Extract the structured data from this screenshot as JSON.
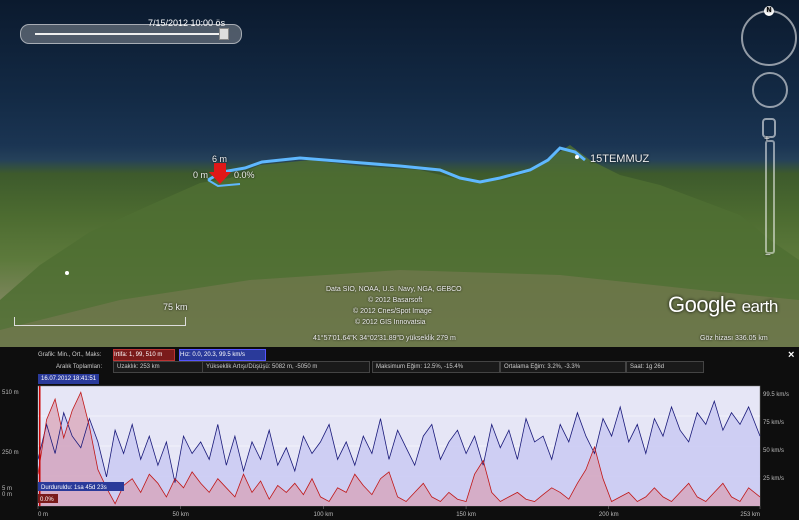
{
  "map": {
    "time_label": "7/15/2012  10:00 ös",
    "place_label": "15TEMMUZ",
    "marker_elev": "6 m",
    "marker_zero": "0 m",
    "marker_pct": "0.0%",
    "scale_label": "75 km",
    "attribution": [
      "Data SIO, NOAA, U.S. Navy, NGA, GEBCO",
      "© 2012 Basarsoft",
      "© 2012 Cnes/Spot Image",
      "© 2012 GIS Innovatsia"
    ],
    "coords": "41°57'01.64\"K  34°02'31.89\"D  yükseklik  279 m",
    "eye_alt": "Göz hizası  336.05 km",
    "logo_google": "Google",
    "logo_earth": "earth",
    "compass_n": "N"
  },
  "panel": {
    "graph_label": "Grafik: Min., Ort., Maks:",
    "elev_stats": "Irtifa: 1, 99, 510 m",
    "speed_stats": "Hız: 0.0, 20.3, 99.5 km/s",
    "range_label": "Aralık Toplamları:",
    "distance": "Uzaklık: 253 km",
    "elev_gain": "Yükseklik Artışı/Düşüşü: 5082 m, -5050 m",
    "max_slope": "Maksimum Eğim: 12.5%, -15.4%",
    "avg_slope": "Ortalama Eğim: 3.2%, -3.3%",
    "time": "Saat: 1g 26d",
    "timestamp": "16.07.2012 18:41:51",
    "stop_label": "Durduruldu: 1sa 45d 23s",
    "close": "×"
  },
  "chart_data": {
    "type": "area",
    "y_left_ticks": [
      "510 m",
      "250 m",
      "5 m"
    ],
    "y_left_minor": "0 m",
    "y_right_ticks": [
      "99.5 km/s",
      "75 km/s",
      "50 km/s",
      "25 km/s"
    ],
    "x_ticks": [
      "0 m",
      "50 km",
      "100 km",
      "150 km",
      "200 km",
      "253 km"
    ],
    "xlim": [
      0,
      253
    ],
    "y_elev_lim": [
      0,
      510
    ],
    "y_speed_lim": [
      0,
      99.5
    ],
    "cursor_pct": "0.0%",
    "series": [
      {
        "name": "Irtifa",
        "color": "#c01818",
        "values": [
          [
            0,
            140
          ],
          [
            3,
            380
          ],
          [
            6,
            470
          ],
          [
            9,
            300
          ],
          [
            12,
            420
          ],
          [
            15,
            500
          ],
          [
            18,
            350
          ],
          [
            21,
            160
          ],
          [
            24,
            80
          ],
          [
            27,
            10
          ],
          [
            30,
            90
          ],
          [
            33,
            120
          ],
          [
            36,
            60
          ],
          [
            39,
            140
          ],
          [
            42,
            100
          ],
          [
            45,
            40
          ],
          [
            48,
            120
          ],
          [
            51,
            80
          ],
          [
            54,
            150
          ],
          [
            57,
            100
          ],
          [
            60,
            60
          ],
          [
            63,
            120
          ],
          [
            66,
            80
          ],
          [
            69,
            40
          ],
          [
            72,
            140
          ],
          [
            75,
            60
          ],
          [
            78,
            110
          ],
          [
            81,
            30
          ],
          [
            84,
            90
          ],
          [
            87,
            60
          ],
          [
            90,
            100
          ],
          [
            93,
            50
          ],
          [
            96,
            120
          ],
          [
            99,
            40
          ],
          [
            102,
            20
          ],
          [
            105,
            80
          ],
          [
            108,
            60
          ],
          [
            111,
            140
          ],
          [
            114,
            90
          ],
          [
            117,
            50
          ],
          [
            120,
            120
          ],
          [
            123,
            150
          ],
          [
            126,
            40
          ],
          [
            129,
            20
          ],
          [
            132,
            60
          ],
          [
            135,
            100
          ],
          [
            138,
            40
          ],
          [
            141,
            20
          ],
          [
            144,
            60
          ],
          [
            147,
            30
          ],
          [
            150,
            20
          ],
          [
            153,
            140
          ],
          [
            156,
            200
          ],
          [
            159,
            60
          ],
          [
            162,
            20
          ],
          [
            165,
            40
          ],
          [
            168,
            60
          ],
          [
            171,
            30
          ],
          [
            174,
            20
          ],
          [
            177,
            50
          ],
          [
            180,
            80
          ],
          [
            183,
            60
          ],
          [
            186,
            30
          ],
          [
            189,
            100
          ],
          [
            192,
            160
          ],
          [
            195,
            260
          ],
          [
            198,
            120
          ],
          [
            201,
            20
          ],
          [
            204,
            40
          ],
          [
            207,
            60
          ],
          [
            210,
            20
          ],
          [
            213,
            40
          ],
          [
            216,
            80
          ],
          [
            219,
            40
          ],
          [
            222,
            20
          ],
          [
            225,
            60
          ],
          [
            228,
            100
          ],
          [
            231,
            40
          ],
          [
            234,
            20
          ],
          [
            237,
            60
          ],
          [
            240,
            100
          ],
          [
            243,
            40
          ],
          [
            246,
            20
          ],
          [
            249,
            80
          ],
          [
            253,
            40
          ]
        ]
      },
      {
        "name": "Hız",
        "color": "#1a1a7a",
        "values": [
          [
            0,
            40
          ],
          [
            3,
            70
          ],
          [
            6,
            45
          ],
          [
            9,
            80
          ],
          [
            12,
            60
          ],
          [
            15,
            50
          ],
          [
            18,
            75
          ],
          [
            21,
            55
          ],
          [
            24,
            25
          ],
          [
            27,
            65
          ],
          [
            30,
            45
          ],
          [
            33,
            70
          ],
          [
            36,
            40
          ],
          [
            39,
            60
          ],
          [
            42,
            35
          ],
          [
            45,
            55
          ],
          [
            48,
            20
          ],
          [
            51,
            60
          ],
          [
            54,
            45
          ],
          [
            57,
            55
          ],
          [
            60,
            40
          ],
          [
            63,
            70
          ],
          [
            66,
            35
          ],
          [
            69,
            60
          ],
          [
            72,
            30
          ],
          [
            75,
            55
          ],
          [
            78,
            40
          ],
          [
            81,
            65
          ],
          [
            84,
            35
          ],
          [
            87,
            50
          ],
          [
            90,
            30
          ],
          [
            93,
            60
          ],
          [
            96,
            45
          ],
          [
            99,
            55
          ],
          [
            102,
            70
          ],
          [
            105,
            40
          ],
          [
            108,
            55
          ],
          [
            111,
            35
          ],
          [
            114,
            60
          ],
          [
            117,
            45
          ],
          [
            120,
            75
          ],
          [
            123,
            40
          ],
          [
            126,
            65
          ],
          [
            129,
            50
          ],
          [
            132,
            35
          ],
          [
            135,
            60
          ],
          [
            138,
            70
          ],
          [
            141,
            40
          ],
          [
            144,
            55
          ],
          [
            147,
            65
          ],
          [
            150,
            45
          ],
          [
            153,
            60
          ],
          [
            156,
            35
          ],
          [
            159,
            70
          ],
          [
            162,
            50
          ],
          [
            165,
            65
          ],
          [
            168,
            40
          ],
          [
            171,
            75
          ],
          [
            174,
            55
          ],
          [
            177,
            60
          ],
          [
            180,
            40
          ],
          [
            183,
            70
          ],
          [
            186,
            55
          ],
          [
            189,
            80
          ],
          [
            192,
            60
          ],
          [
            195,
            45
          ],
          [
            198,
            75
          ],
          [
            201,
            60
          ],
          [
            204,
            85
          ],
          [
            207,
            55
          ],
          [
            210,
            70
          ],
          [
            213,
            45
          ],
          [
            216,
            75
          ],
          [
            219,
            60
          ],
          [
            222,
            85
          ],
          [
            225,
            65
          ],
          [
            228,
            55
          ],
          [
            231,
            80
          ],
          [
            234,
            70
          ],
          [
            237,
            90
          ],
          [
            240,
            65
          ],
          [
            243,
            80
          ],
          [
            246,
            70
          ],
          [
            249,
            85
          ],
          [
            253,
            60
          ]
        ]
      }
    ]
  }
}
